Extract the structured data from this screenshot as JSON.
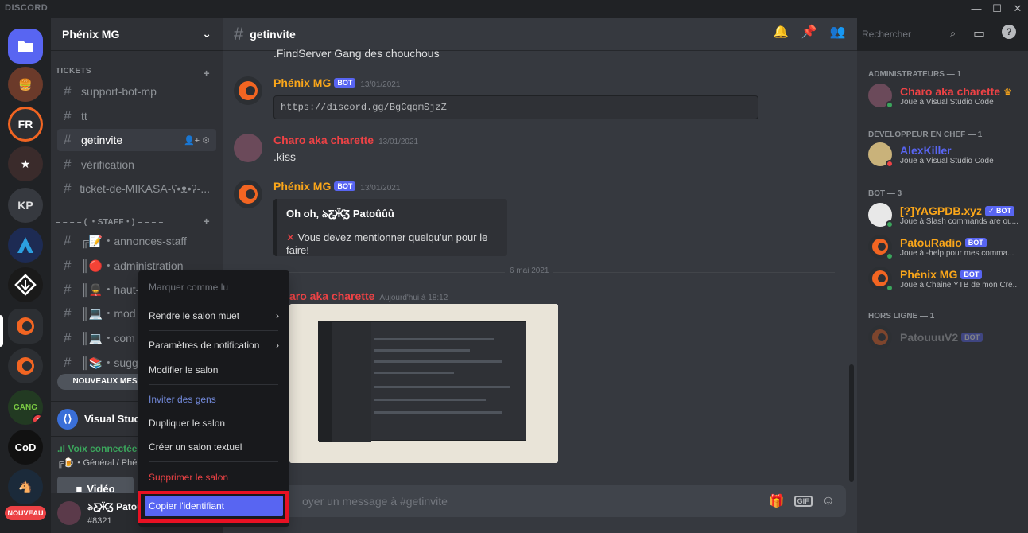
{
  "app": {
    "brand": "DISCORD",
    "min": "—",
    "max": "☐",
    "close": "✕"
  },
  "rail": {
    "servers": [
      "FR",
      "KP",
      "GANG",
      "CoD"
    ],
    "gang_badge": "1",
    "new_label": "NOUVEAU"
  },
  "guild": {
    "name": "Phénix MG",
    "chevron": "⌄"
  },
  "categories": {
    "tickets": "TICKETS",
    "staff": "– – – – ( ・STAFF・) – – – –",
    "plus": "+"
  },
  "channels": [
    {
      "name": "support-bot-mp"
    },
    {
      "name": "tt"
    },
    {
      "name": "getinvite"
    },
    {
      "name": "vérification"
    },
    {
      "name": "ticket-de-MIKASA-ʕ•ᴥ•ʔ-..."
    },
    {
      "name": "╔📝・annonces-staff"
    },
    {
      "name": "║🔴・administration"
    },
    {
      "name": "║💂・haut-"
    },
    {
      "name": "║💻・mod"
    },
    {
      "name": "║💻・com"
    },
    {
      "name": "║📚・sugg"
    }
  ],
  "newmsg": "NOUVEAUX MES",
  "activity": {
    "label": "Visual Studi"
  },
  "voice": {
    "status": ".ıl Voix connectée",
    "channel": "╔🍺・Général / Phé",
    "video": "Vidéo"
  },
  "user": {
    "name": "ঌƸ̵̡Ӝ̵̨̄Ʒ Patoûûû",
    "tag": "#8321"
  },
  "chat": {
    "channel": "getinvite",
    "top_text": ".FindServer Gang des chouchous",
    "messages": [
      {
        "author": "Phénix MG",
        "date": "13/01/2021",
        "code": "https://discord.gg/BgCqqmSjzZ"
      },
      {
        "author": "Charo aka charette",
        "date": "13/01/2021",
        "text": ".kiss"
      },
      {
        "author": "Phénix MG",
        "date": "13/01/2021",
        "embed_title": "Oh oh, ঌƸ̵̡Ӝ̵̨̄Ʒ Patoûûû",
        "embed_desc": "Vous devez mentionner quelqu'un pour le faire!"
      },
      {
        "author": "aro aka charette",
        "date": "Aujourd'hui à 18:12"
      }
    ],
    "divider": "6 mai 2021",
    "bot_label": "BOT",
    "composer_placeholder": "oyer un message à #getinvite",
    "gif": "GIF"
  },
  "search": {
    "placeholder": "Rechercher"
  },
  "members": {
    "groups": [
      {
        "title": "ADMINISTRATEURS — 1"
      },
      {
        "title": "DÉVELOPPEUR EN CHEF — 1"
      },
      {
        "title": "BOT — 3"
      },
      {
        "title": "HORS LIGNE — 1"
      }
    ],
    "list": [
      {
        "name": "Charo aka charette",
        "activity": "Joue à Visual Studio Code",
        "color": "#ed4245"
      },
      {
        "name": "AlexKiller",
        "activity": "Joue à Visual Studio Code",
        "color": "#5865f2"
      },
      {
        "name": "[?]YAGPDB.xyz",
        "activity": "Joue à Slash commands are ou...",
        "color": "#faa61a",
        "badge": "✓ BOT"
      },
      {
        "name": "PatouRadio",
        "activity": "Joue à -help pour mes comma...",
        "color": "#faa61a",
        "badge": "BOT"
      },
      {
        "name": "Phénix MG",
        "activity": "Joue à Chaine YTB de mon Cré...",
        "color": "#faa61a",
        "badge": "BOT"
      },
      {
        "name": "PatouuuV2",
        "activity": "",
        "color": "#72767d",
        "badge": "BOT"
      }
    ]
  },
  "context_menu": {
    "items": [
      {
        "label": "Marquer comme lu"
      },
      {
        "label": "Rendre le salon muet",
        "arrow": "›"
      },
      {
        "label": "Paramètres de notification",
        "arrow": "›"
      },
      {
        "label": "Modifier le salon"
      },
      {
        "label": "Inviter des gens"
      },
      {
        "label": "Dupliquer le salon"
      },
      {
        "label": "Créer un salon textuel"
      },
      {
        "label": "Supprimer le salon"
      },
      {
        "label": "Copier l'identifiant"
      }
    ]
  },
  "colors": {
    "accent": "#5865f2",
    "danger": "#ed4245",
    "online": "#3ba55c",
    "bot_orange": "#faa61a"
  }
}
